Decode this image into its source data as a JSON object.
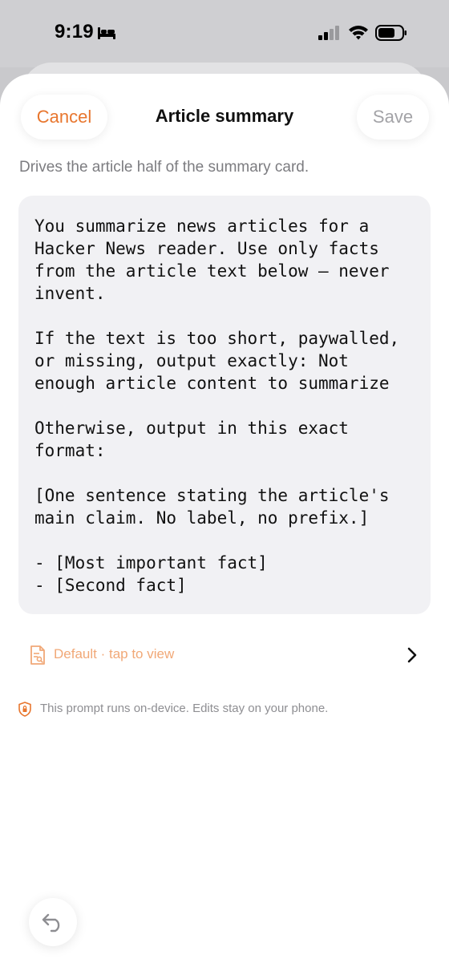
{
  "status_bar": {
    "time": "9:19"
  },
  "header": {
    "cancel_label": "Cancel",
    "title": "Article summary",
    "save_label": "Save"
  },
  "subtitle": "Drives the article half of the summary card.",
  "prompt": {
    "text": "You summarize news articles for a Hacker News reader. Use only facts from the article text below — never invent.\n\nIf the text is too short, paywalled, or missing, output exactly: Not enough article content to summarize\n\nOtherwise, output in this exact format:\n\n[One sentence stating the article's main claim. No label, no prefix.]\n\n- [Most important fact]\n- [Second fact]"
  },
  "default_row": {
    "label": "Default · tap to view"
  },
  "privacy_note": "This prompt runs on-device. Edits stay on your phone.",
  "colors": {
    "accent": "#e8762e",
    "accent_light": "#f1a877",
    "muted": "#8e8e92",
    "prompt_bg": "#f1f1f4"
  },
  "icons": {
    "status": [
      "bed-icon",
      "cellular-signal-icon",
      "wifi-icon",
      "battery-icon"
    ],
    "default_row": "document-icon",
    "chevron": "chevron-right-icon",
    "privacy": "shield-icon",
    "undo": "undo-icon"
  }
}
